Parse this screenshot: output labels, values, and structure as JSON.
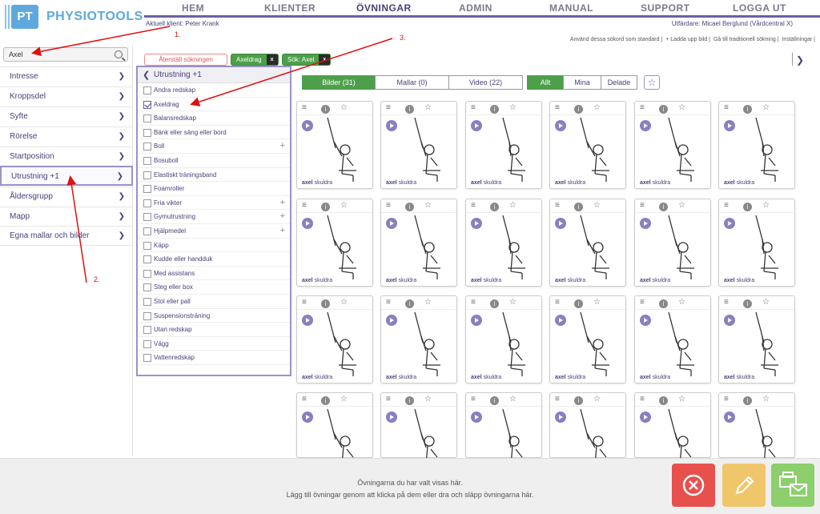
{
  "brand": {
    "logo_text": "PT",
    "name": "PHYSIOTOOLS"
  },
  "nav": {
    "items": [
      "HEM",
      "KLIENTER",
      "ÖVNINGAR",
      "ADMIN",
      "MANUAL",
      "SUPPORT",
      "LOGGA UT"
    ],
    "active": "ÖVNINGAR"
  },
  "client_line": "Aktuell klient: Peter Krank",
  "issuer_line": "Utfärdare: Micael Berglund (Vårdcentral X)",
  "top_links": [
    "Använd dessa sökord som standard",
    "+ Ladda upp bild",
    "Gå till traditionell sökning",
    "Inställningar"
  ],
  "search": {
    "value": "Axel"
  },
  "sidebar": {
    "items": [
      "Intresse",
      "Kroppsdel",
      "Syfte",
      "Rörelse",
      "Startposition",
      "Utrustning  +1",
      "Åldersgrupp",
      "Mapp",
      "Egna mallar och bilder"
    ],
    "selected": "Utrustning  +1"
  },
  "filters": {
    "reset": "Återställ sökningen",
    "chips": [
      "Axeldrag",
      "Sök: Axel"
    ],
    "chip_close": "x"
  },
  "category_panel": {
    "title": "Utrustning  +1",
    "items": [
      {
        "label": "Andra redskap",
        "checked": false,
        "expandable": false
      },
      {
        "label": "Axeldrag",
        "checked": true,
        "expandable": false
      },
      {
        "label": "Balansredskap",
        "checked": false,
        "expandable": false
      },
      {
        "label": "Bänk eller säng eller bord",
        "checked": false,
        "expandable": false
      },
      {
        "label": "Boll",
        "checked": false,
        "expandable": true
      },
      {
        "label": "Bosuboll",
        "checked": false,
        "expandable": false
      },
      {
        "label": "Elastiskt träningsband",
        "checked": false,
        "expandable": false
      },
      {
        "label": "Foamroller",
        "checked": false,
        "expandable": false
      },
      {
        "label": "Fria vikter",
        "checked": false,
        "expandable": true
      },
      {
        "label": "Gymutrustning",
        "checked": false,
        "expandable": true
      },
      {
        "label": "Hjälpmedel",
        "checked": false,
        "expandable": true
      },
      {
        "label": "Käpp",
        "checked": false,
        "expandable": false
      },
      {
        "label": "Kudde eller handduk",
        "checked": false,
        "expandable": false
      },
      {
        "label": "Med assistans",
        "checked": false,
        "expandable": false
      },
      {
        "label": "Steg eller box",
        "checked": false,
        "expandable": false
      },
      {
        "label": "Stol eller pall",
        "checked": false,
        "expandable": false
      },
      {
        "label": "Suspensionsträning",
        "checked": false,
        "expandable": false
      },
      {
        "label": "Utan redskap",
        "checked": false,
        "expandable": false
      },
      {
        "label": "Vägg",
        "checked": false,
        "expandable": false
      },
      {
        "label": "Vattenredskap",
        "checked": false,
        "expandable": false
      }
    ]
  },
  "media_tabs": [
    "Bilder (31)",
    "Mallar (0)",
    "Video (22)"
  ],
  "scope_tabs": [
    "Allt",
    "Mina",
    "Delade"
  ],
  "exercise_caption": {
    "bold": "axel",
    "rest": " skuldra"
  },
  "footer": {
    "line1": "Övningarna du har valt visas här.",
    "line2": "Lägg till övningar genom att klicka på dem eller dra och släpp övningarna här."
  },
  "annotations": [
    "1.",
    "2.",
    "3."
  ],
  "colors": {
    "accent": "#4a3f7a",
    "brand": "#5da9dd",
    "green": "#4e9f4a",
    "red_button": "#e8504d",
    "yellow_button": "#f0c66a",
    "green_button": "#8ccf6c",
    "annotation": "#e01010"
  }
}
